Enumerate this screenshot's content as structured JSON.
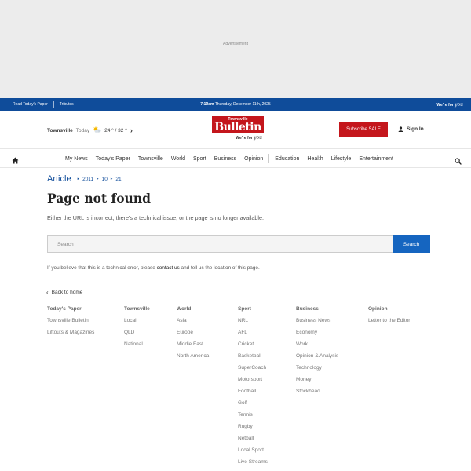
{
  "ad": {
    "label": "Advertisement"
  },
  "topbar": {
    "links": [
      "Read Today's Paper",
      "Tributes"
    ],
    "time": "7:19am",
    "date": "Thursday, December 11th, 2025",
    "brand_a": "We're for",
    "brand_b": "you"
  },
  "masthead": {
    "weather": {
      "location": "Townsville",
      "today": "Today",
      "temp": "24 ° / 32 °",
      "icon": "partly-cloudy-icon"
    },
    "logo": {
      "small": "Townsville",
      "big": "Bulletin",
      "tag_a": "We're for",
      "tag_b": "you"
    },
    "subscribe_label": "Subscribe SALE",
    "signin_label": "Sign In"
  },
  "nav": {
    "items": [
      "My News",
      "Today's Paper",
      "Townsville",
      "World",
      "Sport",
      "Business",
      "Opinion",
      "Education",
      "Health",
      "Lifestyle",
      "Entertainment"
    ]
  },
  "breadcrumb": {
    "main": "Article",
    "year": "2011",
    "month": "10",
    "day": "21"
  },
  "page": {
    "title": "Page not found",
    "description": "Either the URL is incorrect, there's a technical issue, or the page is no longer available."
  },
  "search": {
    "placeholder": "Search",
    "button": "Search"
  },
  "tech_note": {
    "before": "If you believe that this is a technical error, please ",
    "link": "contact us",
    "after": " and tell us the location of this page."
  },
  "back_home": "Back to home",
  "footer": {
    "columns": [
      {
        "heading": "Today's Paper",
        "links": [
          "Townsville Bulletin",
          "Liftouts & Magazines"
        ]
      },
      {
        "heading": "Townsville",
        "links": [
          "Local",
          "QLD",
          "National"
        ]
      },
      {
        "heading": "World",
        "links": [
          "Asia",
          "Europe",
          "Middle East",
          "North America"
        ]
      },
      {
        "heading": "Sport",
        "links": [
          "NRL",
          "AFL",
          "Cricket",
          "Basketball",
          "SuperCoach",
          "Motorsport",
          "Football",
          "Golf",
          "Tennis",
          "Rugby",
          "Netball",
          "Local Sport",
          "Live Streams"
        ]
      },
      {
        "heading": "Business",
        "links": [
          "Business News",
          "Economy",
          "Work",
          "Opinion & Analysis",
          "Technology",
          "Money",
          "Stockhead"
        ]
      },
      {
        "heading": "Opinion",
        "links": [
          "Letter to the Editor"
        ]
      }
    ]
  }
}
